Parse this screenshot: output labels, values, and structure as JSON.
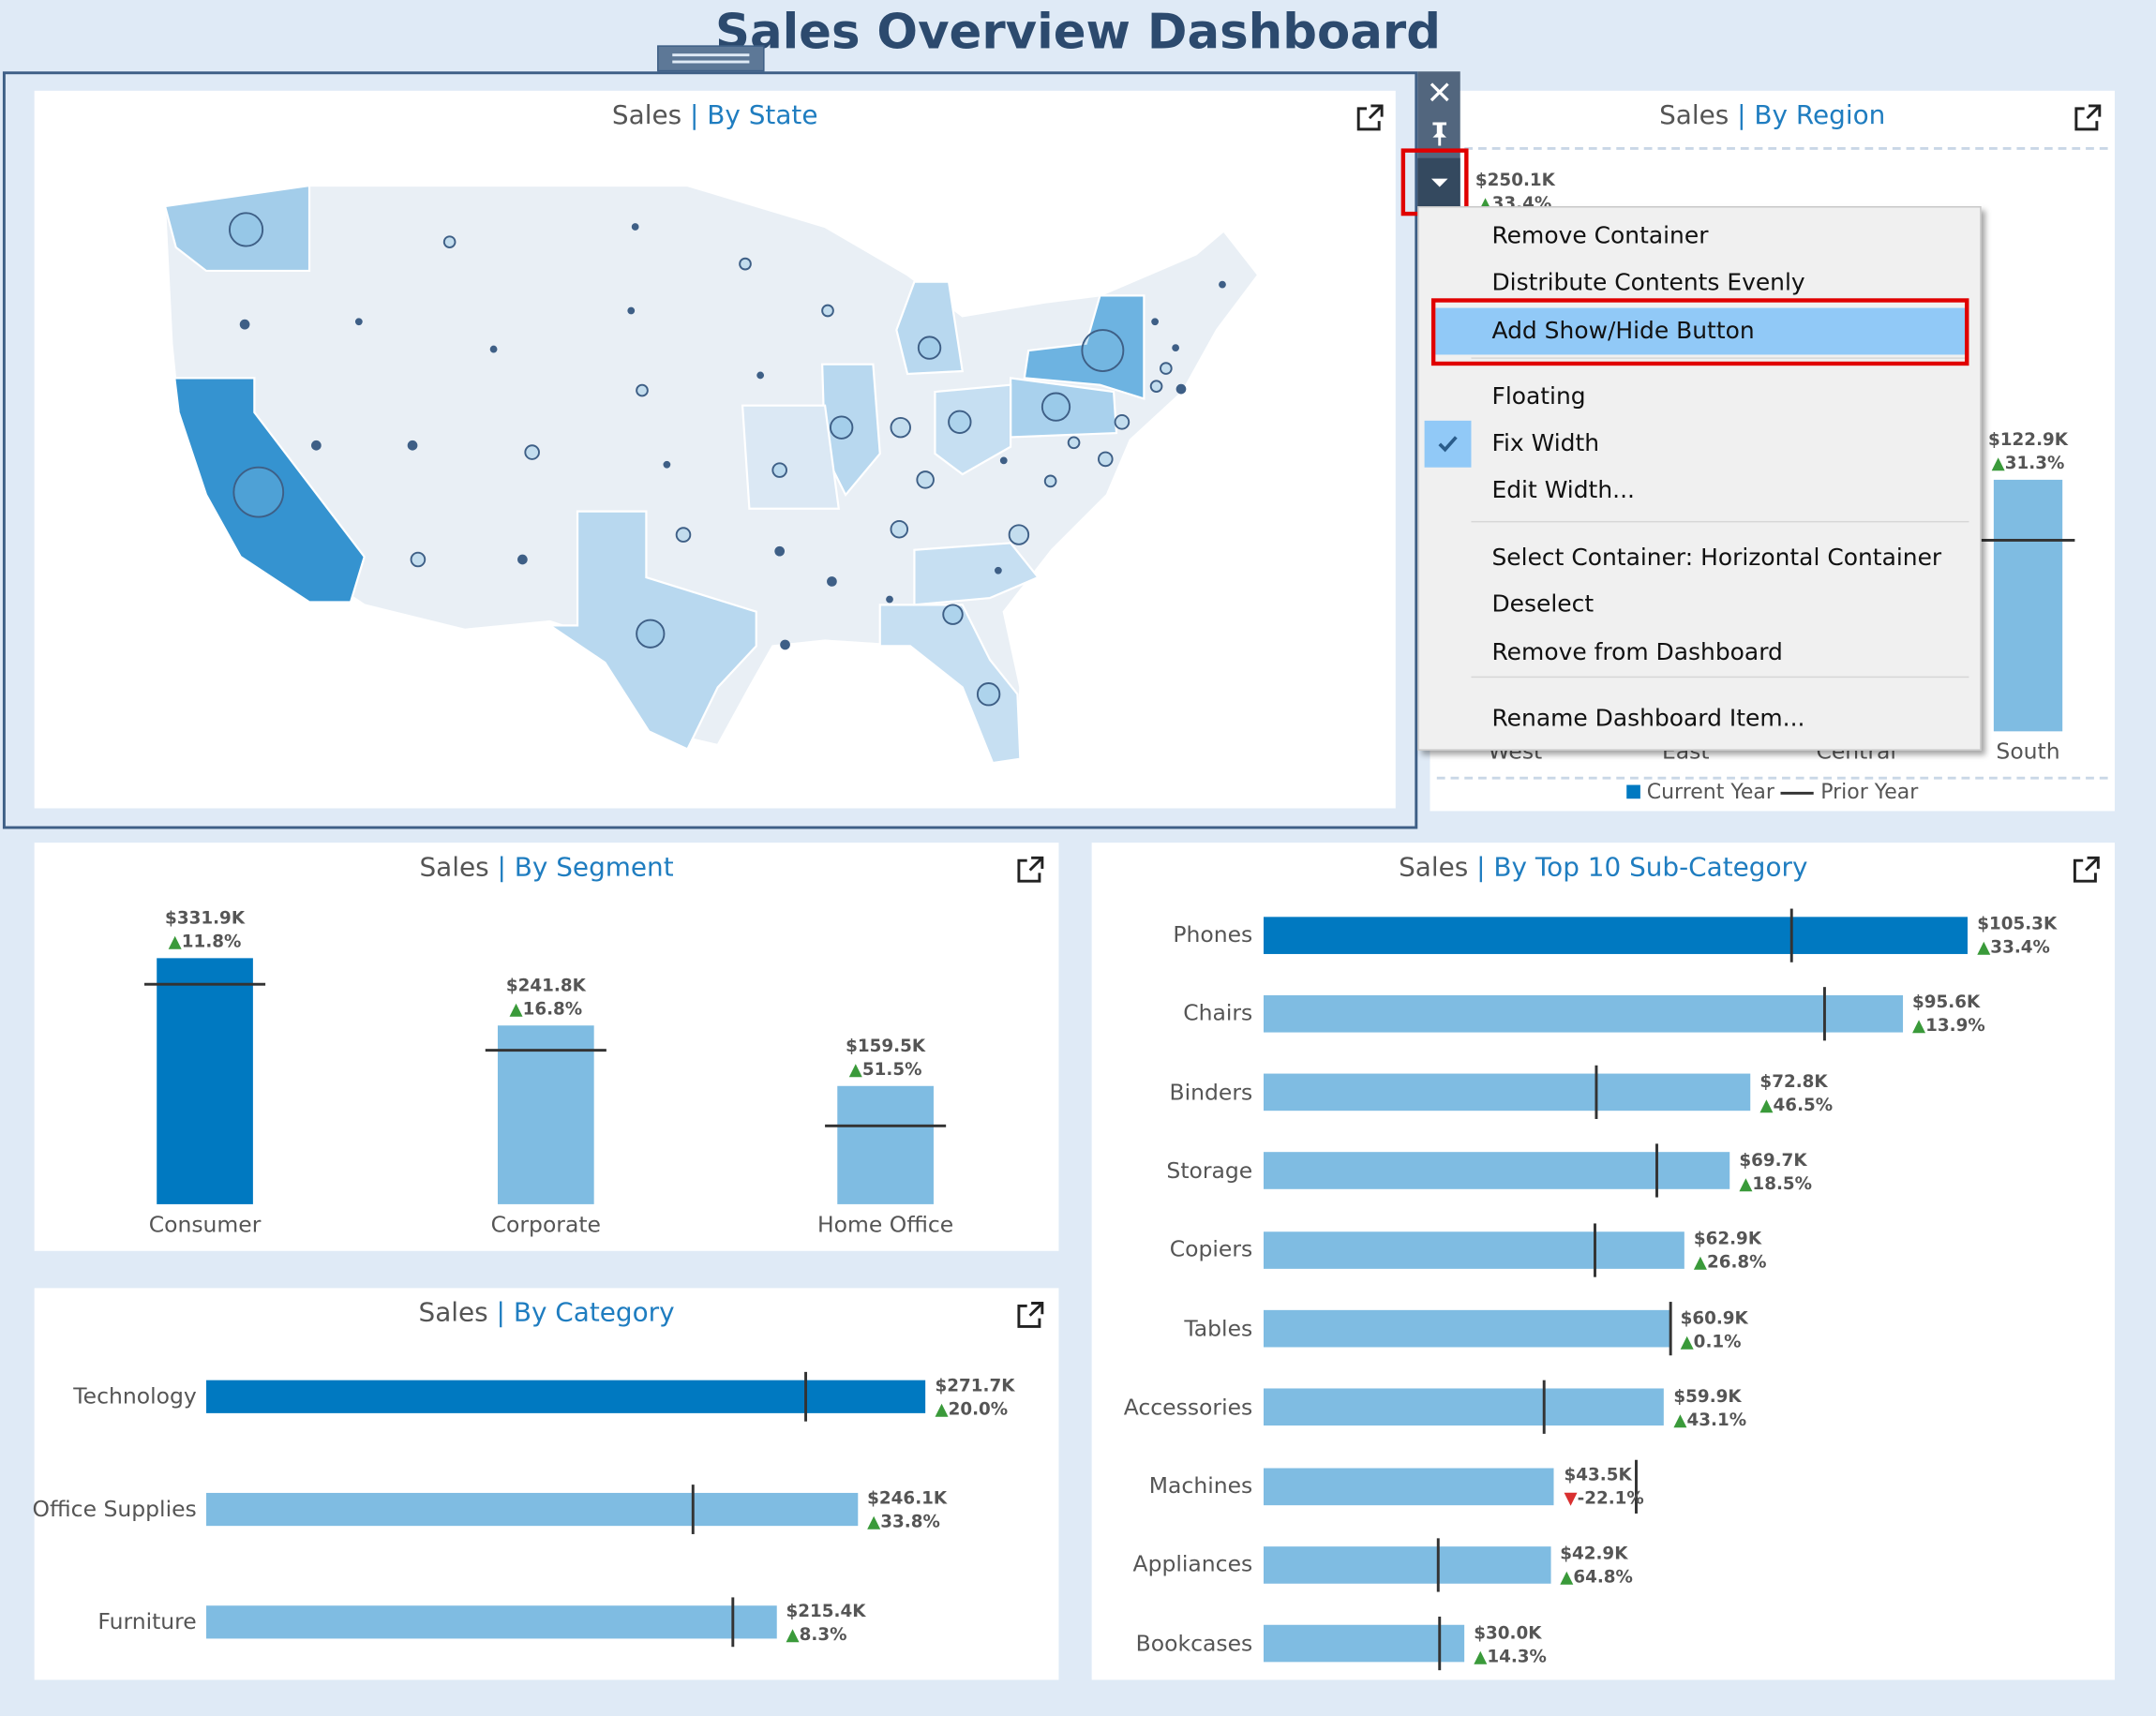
{
  "title": "Sales Overview Dashboard",
  "colors": {
    "background": "#dfeaf6",
    "highlight_bar": "#0079c1",
    "bar": "#7fbce2",
    "prior_year_marker": "#333333",
    "accent_text": "#1f7dc0",
    "increase": "#3a9a3a",
    "decrease": "#d93030",
    "menu_highlight": "#91c9f7",
    "annotation_box": "#e00000"
  },
  "panels": {
    "state": {
      "prefix": "Sales",
      "separator": "|",
      "suffix": "By State",
      "icon": "export-icon"
    },
    "region": {
      "prefix": "Sales",
      "separator": "|",
      "suffix": "By Region",
      "icon": "export-icon"
    },
    "segment": {
      "prefix": "Sales",
      "separator": "|",
      "suffix": "By Segment",
      "icon": "export-icon"
    },
    "category": {
      "prefix": "Sales",
      "separator": "|",
      "suffix": "By Category",
      "icon": "export-icon"
    },
    "subcategory": {
      "prefix": "Sales",
      "separator": "|",
      "suffix": "By Top 10 Sub-Category",
      "icon": "export-icon"
    }
  },
  "toolbar": {
    "icons": [
      "close-icon",
      "pin-icon",
      "dropdown-arrow-icon"
    ]
  },
  "context_menu": {
    "items": [
      "Remove Container",
      "Distribute Contents Evenly",
      "Add Show/Hide Button",
      "Floating",
      "Fix Width",
      "Edit Width...",
      "Select Container: Horizontal Container",
      "Deselect",
      "Remove from Dashboard",
      "Rename Dashboard Item..."
    ],
    "highlighted": "Add Show/Hide Button",
    "checked": "Fix Width"
  },
  "chart_data": [
    {
      "id": "region",
      "type": "bar",
      "orientation": "vertical",
      "categories": [
        "West",
        "East",
        "Central",
        "South"
      ],
      "values_k": [
        250.1,
        null,
        null,
        122.9
      ],
      "change_pct": [
        33.4,
        null,
        null,
        31.3
      ],
      "legend": [
        "Current Year",
        "Prior Year"
      ],
      "legend_position": "bottom"
    },
    {
      "id": "segment",
      "type": "bar",
      "orientation": "vertical",
      "categories": [
        "Consumer",
        "Corporate",
        "Home Office"
      ],
      "values_k": [
        331.9,
        241.8,
        159.5
      ],
      "change_pct": [
        11.8,
        16.8,
        51.5
      ]
    },
    {
      "id": "category",
      "type": "bar",
      "orientation": "horizontal",
      "categories": [
        "Technology",
        "Office Supplies",
        "Furniture"
      ],
      "values_k": [
        271.7,
        246.1,
        215.4
      ],
      "change_pct": [
        20.0,
        33.8,
        8.3
      ]
    },
    {
      "id": "subcategory",
      "type": "bar",
      "orientation": "horizontal",
      "categories": [
        "Phones",
        "Chairs",
        "Binders",
        "Storage",
        "Copiers",
        "Tables",
        "Accessories",
        "Machines",
        "Appliances",
        "Bookcases"
      ],
      "values_k": [
        105.3,
        95.6,
        72.8,
        69.7,
        62.9,
        60.9,
        59.9,
        43.5,
        42.9,
        30.0
      ],
      "change_pct": [
        33.4,
        13.9,
        46.5,
        18.5,
        26.8,
        0.1,
        43.1,
        -22.1,
        64.8,
        14.3
      ]
    }
  ]
}
